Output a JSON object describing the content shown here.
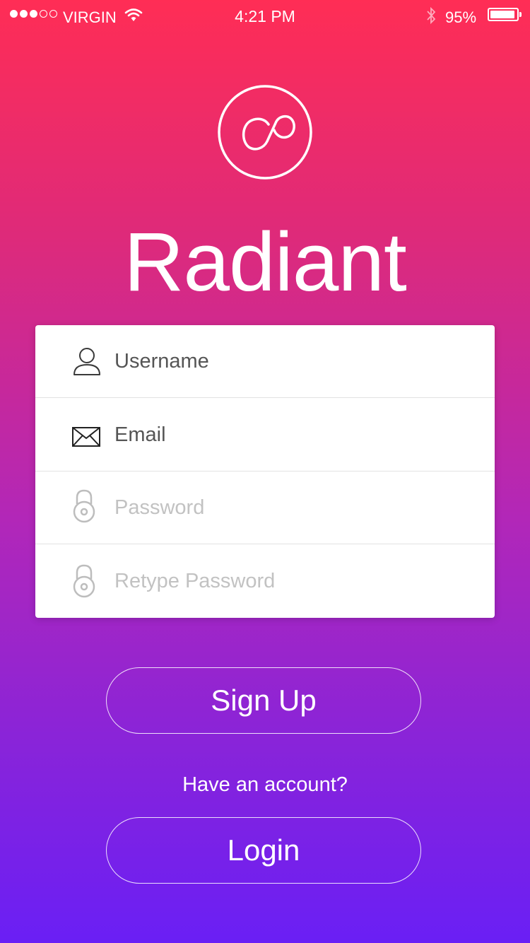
{
  "status_bar": {
    "carrier": "VIRGIN",
    "time": "4:21 PM",
    "battery_percent": "95%",
    "battery_level": 0.95,
    "signal_bars_filled": 3,
    "signal_bars_total": 5
  },
  "brand": {
    "name": "Radiant",
    "logo_icon": "link-loop-icon"
  },
  "form": {
    "fields": [
      {
        "placeholder": "Username",
        "icon": "user-icon"
      },
      {
        "placeholder": "Email",
        "icon": "envelope-icon"
      },
      {
        "placeholder": "Password",
        "icon": "lock-icon"
      },
      {
        "placeholder": "Retype Password",
        "icon": "lock-icon"
      }
    ]
  },
  "actions": {
    "signup_label": "Sign Up",
    "have_account_text": "Have an account?",
    "login_label": "Login"
  },
  "colors": {
    "gradient_top": "#ff2d55",
    "gradient_bottom": "#6a1ff5",
    "card_background": "#ffffff"
  }
}
